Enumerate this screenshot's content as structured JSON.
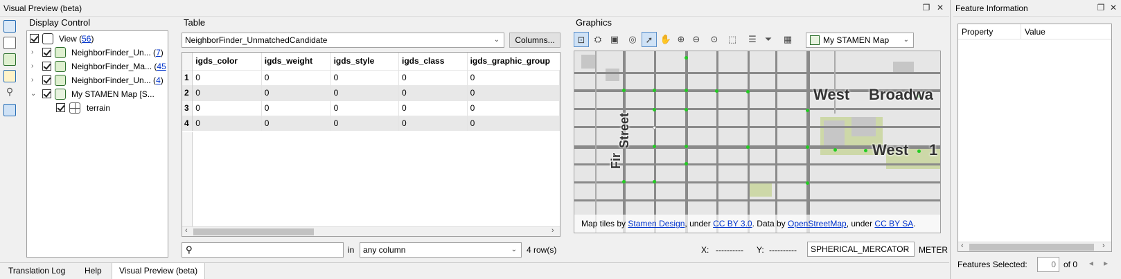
{
  "window": {
    "title": "Visual Preview (beta)"
  },
  "feature_info": {
    "title": "Feature Information",
    "columns": [
      "Property",
      "Value"
    ],
    "features_selected_label": "Features Selected:",
    "features_selected_value": "0",
    "of_label": "of 0"
  },
  "display_control": {
    "title": "Display Control",
    "view": {
      "label": "View (",
      "count": "56",
      "close": ")"
    },
    "layers": [
      {
        "label": "NeighborFinder_Un... (",
        "count": "7",
        "close": ")"
      },
      {
        "label": "NeighborFinder_Ma... (",
        "count": "45",
        "close": ""
      },
      {
        "label": "NeighborFinder_Un... (",
        "count": "4",
        "close": ")"
      },
      {
        "label": "My STAMEN Map [S...",
        "count": "",
        "close": ""
      }
    ],
    "sublayer": {
      "label": "terrain"
    }
  },
  "table": {
    "title": "Table",
    "selected_table": "NeighborFinder_UnmatchedCandidate",
    "columns_button": "Columns...",
    "headers": [
      "igds_color",
      "igds_weight",
      "igds_style",
      "igds_class",
      "igds_graphic_group"
    ],
    "rows": [
      {
        "n": "1",
        "cells": [
          "0",
          "0",
          "0",
          "0",
          "0"
        ]
      },
      {
        "n": "2",
        "cells": [
          "0",
          "0",
          "0",
          "0",
          "0"
        ]
      },
      {
        "n": "3",
        "cells": [
          "0",
          "0",
          "0",
          "0",
          "0"
        ]
      },
      {
        "n": "4",
        "cells": [
          "0",
          "0",
          "0",
          "0",
          "0"
        ]
      }
    ],
    "search_placeholder": "",
    "in_label": "in",
    "column_filter": "any column",
    "row_count": "4 row(s)"
  },
  "graphics": {
    "title": "Graphics",
    "map_selector": "My STAMEN Map",
    "street_labels": [
      "West",
      "Broadwa",
      "West",
      "1",
      "Fir",
      "Street"
    ],
    "attribution": {
      "prefix": "Map tiles by",
      "link1": "Stamen Design",
      "mid1": ", under",
      "link2": "CC BY 3.0",
      "mid2": ". Data by",
      "link3": "OpenStreetMap",
      "mid3": ", under",
      "link4": "CC BY SA",
      "suffix": "."
    },
    "x_label": "X:",
    "x_value": "----------",
    "y_label": "Y:",
    "y_value": "----------",
    "projection": "SPHERICAL_MERCATOR",
    "units": "METER"
  },
  "bottom_tabs": [
    "Translation Log",
    "Help",
    "Visual Preview (beta)"
  ]
}
